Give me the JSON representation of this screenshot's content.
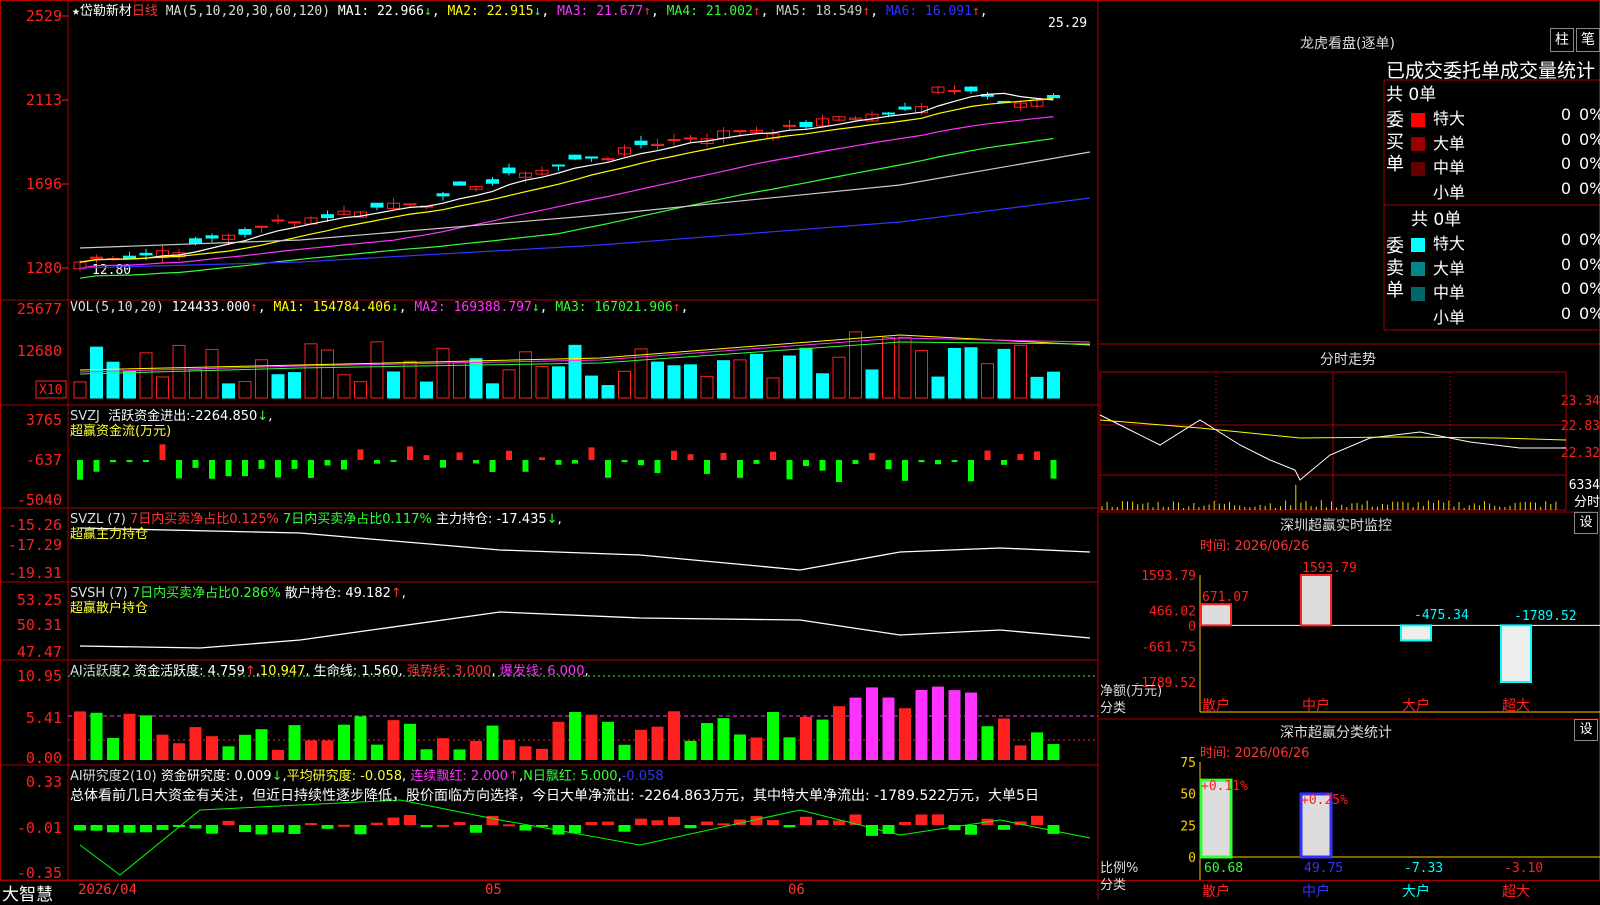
{
  "stock": {
    "name_prefix": "★",
    "name": "岱勒新材",
    "period": "日线",
    "ma_params": "MA(5,10,20,30,60,120)",
    "ma": [
      {
        "label": "MA1:",
        "value": "22.966",
        "arrow": "↓",
        "color": "#ffffff"
      },
      {
        "label": "MA2:",
        "value": "22.915",
        "arrow": "↓",
        "color": "#ffff00"
      },
      {
        "label": "MA3:",
        "value": "21.677",
        "arrow": "↑",
        "color": "#ff33ff"
      },
      {
        "label": "MA4:",
        "value": "21.002",
        "arrow": "↑",
        "color": "#33ff33"
      },
      {
        "label": "MA5:",
        "value": "18.549",
        "arrow": "↑",
        "color": "#cccccc"
      },
      {
        "label": "MA6:",
        "value": "16.091",
        "arrow": "↑",
        "color": "#3333ff"
      }
    ],
    "max_price": "25.29",
    "min_price": "12.80"
  },
  "price_axis": [
    "2529",
    "2113",
    "1696",
    "1280"
  ],
  "vol": {
    "params": "VOL(5,10,20)",
    "value": "124433.000",
    "arrow": "↑",
    "ma": [
      {
        "label": "MA1:",
        "value": "154784.406",
        "arrow": "↓",
        "color": "#ffff00"
      },
      {
        "label": "MA2:",
        "value": "169388.797",
        "arrow": "↓",
        "color": "#ff33ff"
      },
      {
        "label": "MA3:",
        "value": "167021.906",
        "arrow": "↑",
        "color": "#33ff33"
      }
    ],
    "axis": [
      "25677",
      "12680"
    ],
    "unit": "X10"
  },
  "svzj": {
    "name": "SVZJ",
    "label": "活跃资金进出:",
    "value": "-2264.850",
    "arrow": "↓",
    "subtitle": "超赢资金流(万元)",
    "axis": [
      "3765",
      "-637",
      "-5040"
    ]
  },
  "svzl": {
    "name": "SVZL (7)",
    "t1": "7日内买卖净占比0.125%",
    "t2": "7日内买卖净占比0.117%",
    "t3": "主力持仓: -17.435",
    "arrow": "↓",
    "subtitle": "超赢主力持仓",
    "axis": [
      "-15.26",
      "-17.29",
      "-19.31"
    ]
  },
  "svsh": {
    "name": "SVSH (7)",
    "t1": "7日内买卖净占比0.286%",
    "t2": "散户持仓: 49.182",
    "arrow": "↑",
    "subtitle": "超赢散户持仓",
    "axis": [
      "53.25",
      "50.31",
      "47.47"
    ]
  },
  "ai1": {
    "name": "AI活跃度2",
    "t1": "资金活跃度: 4.759",
    "t1_arrow": "↑",
    "t2": "10.947",
    "t3": "生命线: 1.560",
    "t4": "强势线: 3.000",
    "t5": "爆发线: 6.000",
    "axis": [
      "10.95",
      "5.41",
      "0.00"
    ]
  },
  "ai2": {
    "name": "AI研究度2(10)",
    "t1": "资金研究度: 0.009",
    "t1_arrow": "↓",
    "t2": "平均研究度: -0.058",
    "t3": "连续飘红: 2.000",
    "t3_arrow": "↑",
    "t4": "N日飘红: 5.000",
    "t5": "-0.058",
    "summary": "总体看前几日大资金有关注，但近日持续性逐步降低，股价面临方向选择，今日大单净流出: -2264.863万元，其中特大单净流出: -1789.522万元，大单5日",
    "axis": [
      "0.33",
      "-0.01",
      "-0.35"
    ]
  },
  "date_axis": {
    "d1": "2026/04",
    "d2": "05",
    "d3": "06"
  },
  "brand": "大智慧",
  "longhu": {
    "title": "龙虎看盘(逐单)",
    "btn1": "柱",
    "btn2": "笔",
    "header": "已成交委托单成交量统计",
    "buy": {
      "side": "委买单",
      "total": "共 0单",
      "rows": [
        {
          "label": "特大",
          "v": "0",
          "p": "0%",
          "color": "#ff0000"
        },
        {
          "label": "大单",
          "v": "0",
          "p": "0%",
          "color": "#990000"
        },
        {
          "label": "中单",
          "v": "0",
          "p": "0%",
          "color": "#660000"
        },
        {
          "label": "小单",
          "v": "0",
          "p": "0%",
          "color": "#000000"
        }
      ]
    },
    "sell": {
      "side": "委卖单",
      "total": "共 0单",
      "rows": [
        {
          "label": "特大",
          "v": "0",
          "p": "0%",
          "color": "#00ffff"
        },
        {
          "label": "大单",
          "v": "0",
          "p": "0%",
          "color": "#008888"
        },
        {
          "label": "中单",
          "v": "0",
          "p": "0%",
          "color": "#006666"
        },
        {
          "label": "小单",
          "v": "0",
          "p": "0%",
          "color": "#000000"
        }
      ]
    }
  },
  "intraday": {
    "title": "分时走势",
    "axis": [
      "23.34",
      "22.83",
      "22.32"
    ],
    "vol_label": "6334",
    "time_label": "分时"
  },
  "monitor": {
    "title": "深圳超赢实时监控",
    "set": "设",
    "time": "时间: 2026/06/26",
    "axis": [
      "1593.79",
      "466.02",
      "0",
      "-661.75",
      "-1789.52"
    ],
    "ylabel": "净额(万元)",
    "xlabel": "分类",
    "categories": [
      "散户",
      "中户",
      "大户",
      "超大"
    ]
  },
  "classify": {
    "title": "深市超赢分类统计",
    "set": "设",
    "time": "时间: 2026/06/26",
    "axis": [
      "75",
      "50",
      "25",
      "0"
    ],
    "ylabel": "比例%",
    "xlabel": "分类",
    "categories": [
      "散户",
      "中户",
      "大户",
      "超大"
    ]
  },
  "chart_data": [
    {
      "type": "bar",
      "title": "深圳超赢实时监控",
      "ylabel": "净额(万元)",
      "xlabel": "分类",
      "categories": [
        "散户",
        "中户",
        "大户",
        "超大"
      ],
      "values": [
        671.07,
        1593.79,
        -475.34,
        -1789.52
      ],
      "labels": [
        "671.07",
        "1593.79",
        "-475.34",
        "-1789.52"
      ],
      "ylim": [
        -1789.52,
        1593.79
      ]
    },
    {
      "type": "bar",
      "title": "深市超赢分类统计",
      "ylabel": "比例%",
      "xlabel": "分类",
      "categories": [
        "散户",
        "中户",
        "大户",
        "超大"
      ],
      "values": [
        60.68,
        49.75,
        -7.33,
        -3.1
      ],
      "top_labels": [
        "+0.11%",
        "+0.25%",
        "",
        ""
      ],
      "bottom_labels": [
        "60.68",
        "49.75",
        "-7.33",
        "-3.10"
      ],
      "ylim": [
        0,
        75
      ]
    }
  ]
}
